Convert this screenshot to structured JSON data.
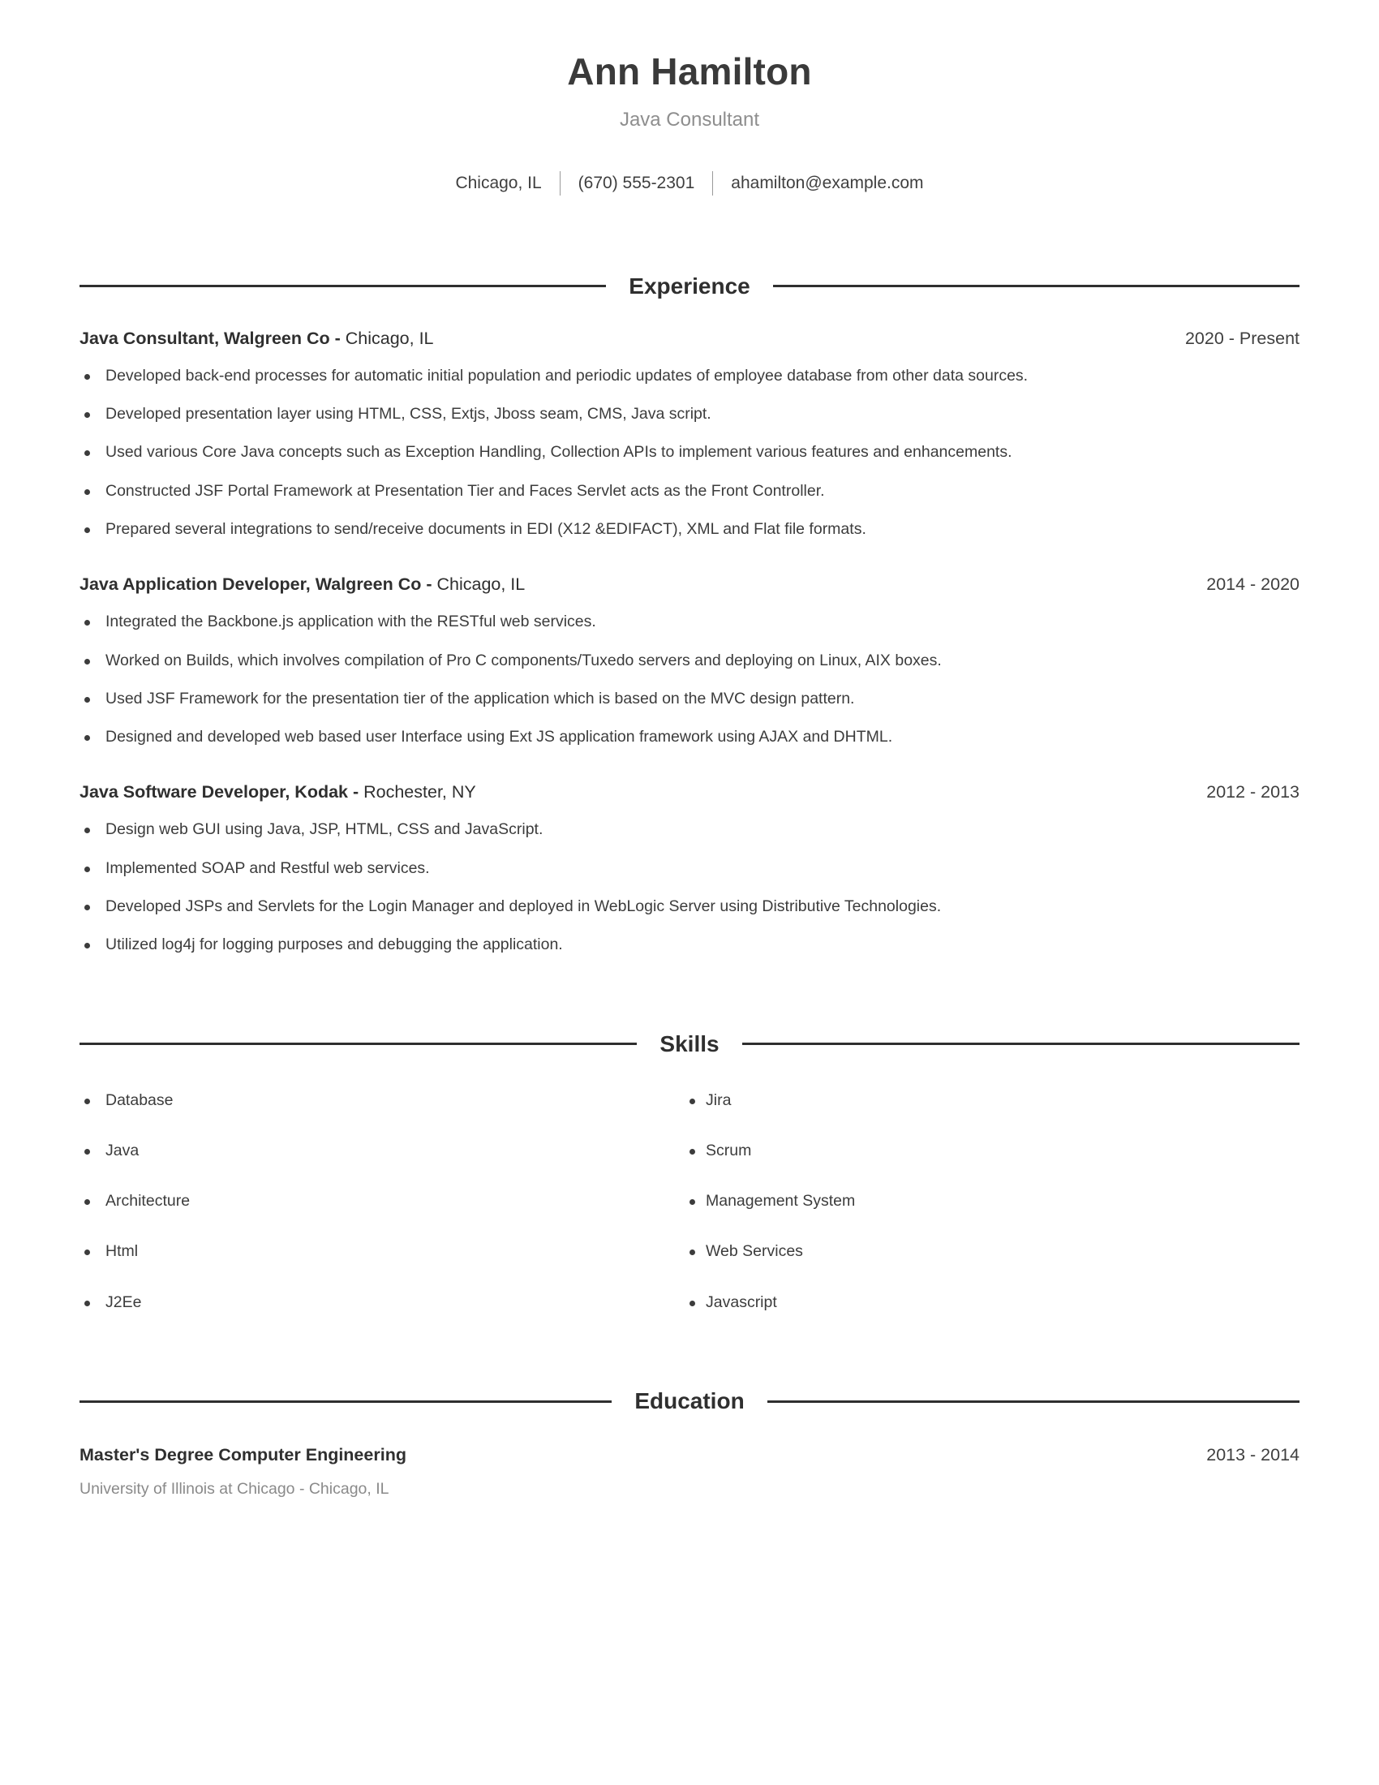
{
  "header": {
    "full_name": "Ann Hamilton",
    "job_title": "Java Consultant",
    "contact": {
      "location": "Chicago, IL",
      "phone": "(670) 555-2301",
      "email": "ahamilton@example.com"
    }
  },
  "sections": {
    "experience": {
      "title": "Experience",
      "entries": [
        {
          "role_bold": "Java Consultant, Walgreen Co -",
          "role_rest": " Chicago, IL",
          "dates": "2020 - Present",
          "bullets": [
            "Developed back-end processes for automatic initial population and periodic updates of employee database from other data sources.",
            "Developed presentation layer using HTML, CSS, Extjs, Jboss seam, CMS, Java script.",
            "Used various Core Java concepts such as Exception Handling, Collection APIs to implement various features and enhancements.",
            "Constructed JSF Portal Framework at Presentation Tier and Faces Servlet acts as the Front Controller.",
            "Prepared several integrations to send/receive documents in EDI (X12 &EDIFACT), XML and Flat file formats."
          ]
        },
        {
          "role_bold": "Java Application Developer, Walgreen Co -",
          "role_rest": " Chicago, IL",
          "dates": "2014 - 2020",
          "bullets": [
            "Integrated the Backbone.js application with the RESTful web services.",
            "Worked on Builds, which involves compilation of Pro C components/Tuxedo servers and deploying on Linux, AIX boxes.",
            "Used JSF Framework for the presentation tier of the application which is based on the MVC design pattern.",
            "Designed and developed web based user Interface using Ext JS application framework using AJAX and DHTML."
          ]
        },
        {
          "role_bold": "Java Software Developer, Kodak -",
          "role_rest": " Rochester, NY",
          "dates": "2012 - 2013",
          "bullets": [
            "Design web GUI using Java, JSP, HTML, CSS and JavaScript.",
            "Implemented SOAP and Restful web services.",
            "Developed JSPs and Servlets for the Login Manager and deployed in WebLogic Server using Distributive Technologies.",
            "Utilized log4j for logging purposes and debugging the application."
          ]
        }
      ]
    },
    "skills": {
      "title": "Skills",
      "left_column": [
        "Database",
        "Java",
        "Architecture",
        "Html",
        "J2Ee"
      ],
      "right_column": [
        "Jira",
        "Scrum",
        "Management System",
        "Web Services",
        "Javascript"
      ]
    },
    "education": {
      "title": "Education",
      "entries": [
        {
          "degree": "Master's Degree Computer Engineering",
          "dates": "2013 - 2014",
          "school": "University of Illinois at Chicago - Chicago, IL"
        }
      ]
    }
  },
  "colors": {
    "text_primary": "#333333",
    "text_muted": "#8e8e8e",
    "rule": "#2f2f2f",
    "page_background": "#ffffff"
  }
}
